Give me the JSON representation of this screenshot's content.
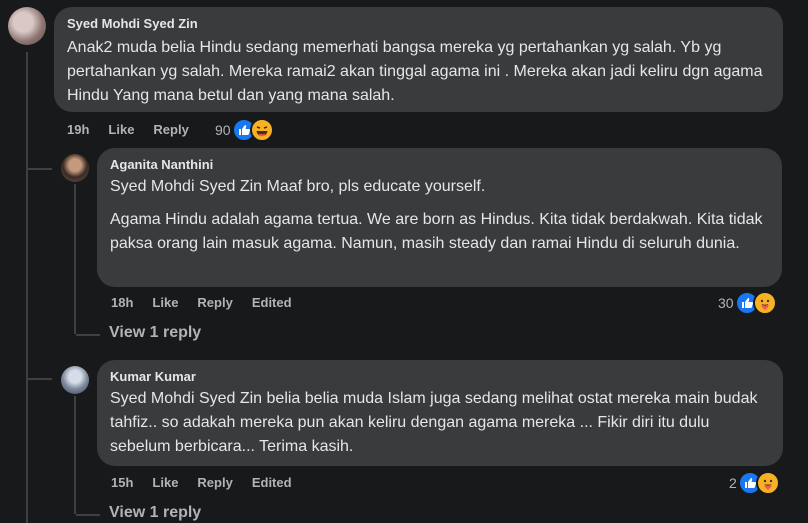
{
  "comments": [
    {
      "author": "Syed Mohdi Syed Zin",
      "text": [
        "Anak2 muda belia Hindu sedang memerhati bangsa mereka yg pertahankan yg salah. Yb yg pertahankan yg salah. Mereka ramai2 akan tinggal agama ini . Mereka akan jadi keliru dgn agama Hindu Yang mana betul dan yang mana salah."
      ],
      "time": "19h",
      "like": "Like",
      "reply": "Reply",
      "edited": "",
      "reaction_count": "90",
      "reactions": [
        "like-icon",
        "haha-icon"
      ]
    },
    {
      "author": "Aganita Nanthini",
      "text": [
        "Syed Mohdi Syed Zin Maaf bro, pls educate yourself.",
        "Agama Hindu adalah agama tertua. We are born as Hindus. Kita tidak berdakwah. Kita tidak paksa orang lain masuk agama. Namun, masih steady dan ramai Hindu di seluruh dunia."
      ],
      "time": "18h",
      "like": "Like",
      "reply": "Reply",
      "edited": "Edited",
      "reaction_count": "30",
      "reactions": [
        "like-icon",
        "care-icon"
      ],
      "view_reply": "View 1 reply"
    },
    {
      "author": "Kumar Kumar",
      "text": [
        "Syed Mohdi Syed Zin belia belia muda Islam juga sedang melihat ostat mereka main budak tahfiz.. so adakah mereka pun akan keliru dengan agama mereka ... Fikir diri itu dulu sebelum berbicara... Terima kasih."
      ],
      "time": "15h",
      "like": "Like",
      "reply": "Reply",
      "edited": "Edited",
      "reaction_count": "2",
      "reactions": [
        "like-icon",
        "care-icon"
      ],
      "view_reply": "View 1 reply"
    }
  ],
  "colors": {
    "bg": "#18191a",
    "bubble": "#3a3b3c",
    "text": "#e4e6eb",
    "muted": "#b0b3b8",
    "like": "#1877f2",
    "emoji": "#f7b125"
  }
}
